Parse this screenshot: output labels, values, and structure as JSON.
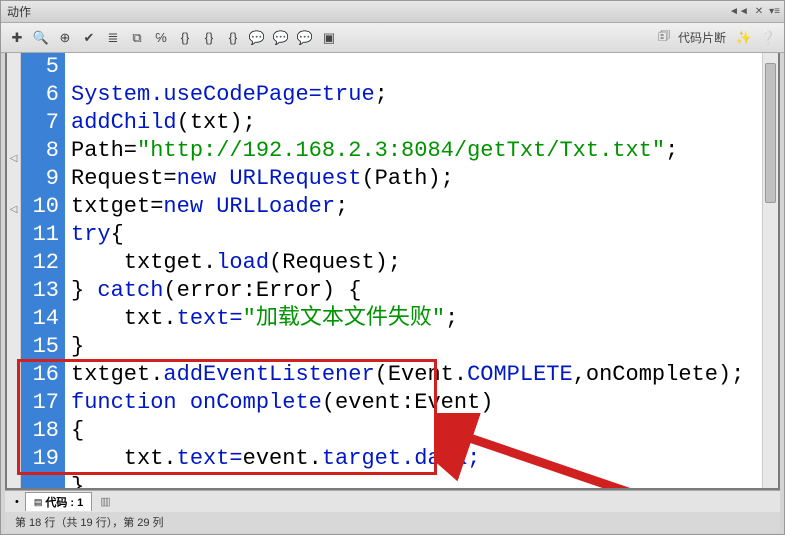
{
  "title": "动作",
  "toolbar": {
    "snippet": "代码片断"
  },
  "gutter": [
    "5",
    "6",
    "7",
    "8",
    "9",
    "10",
    "11",
    "12",
    "13",
    "14",
    "15",
    "16",
    "17",
    "18",
    "19"
  ],
  "code": {
    "l5": {
      "a": "System.",
      "b": "useCodePage=",
      "c": "true",
      "d": ";"
    },
    "l6": {
      "a": "addChild",
      "b": "(txt);"
    },
    "l7": {
      "a": "Path=",
      "b": "\"http://192.168.2.3:8084/getTxt/Txt.txt\"",
      "c": ";"
    },
    "l8": {
      "a": "Request=",
      "b": "new",
      "c": " URLRequest",
      "d": "(Path);"
    },
    "l9": {
      "a": "txtget=",
      "b": "new",
      "c": " URLLoader",
      "d": ";"
    },
    "l10": {
      "a": "try",
      "b": "{"
    },
    "l11": {
      "a": "    txtget.",
      "b": "load",
      "c": "(Request);"
    },
    "l12": {
      "a": "} ",
      "b": "catch",
      "c": "(error:Error) {"
    },
    "l13": {
      "a": "    txt.",
      "b": "text=",
      "c": "\"加载文本文件失败\"",
      "d": ";"
    },
    "l14": {
      "a": "}"
    },
    "l15": {
      "a": "txtget.",
      "b": "addEventListener",
      "c": "(Event.",
      "d": "COMPLETE",
      "e": ",onComplete);"
    },
    "l16": {
      "a": "function",
      "b": " onComplete",
      "c": "(event:Event)"
    },
    "l17": {
      "a": "{"
    },
    "l18": {
      "a": "    txt.",
      "b": "text=",
      "c": "event.",
      "d": "target.data;"
    },
    "l19": {
      "a": "}"
    }
  },
  "tabs": {
    "code": "代码",
    "codeNum": "1"
  },
  "status": "第 18 行（共 19 行），第 29 列"
}
